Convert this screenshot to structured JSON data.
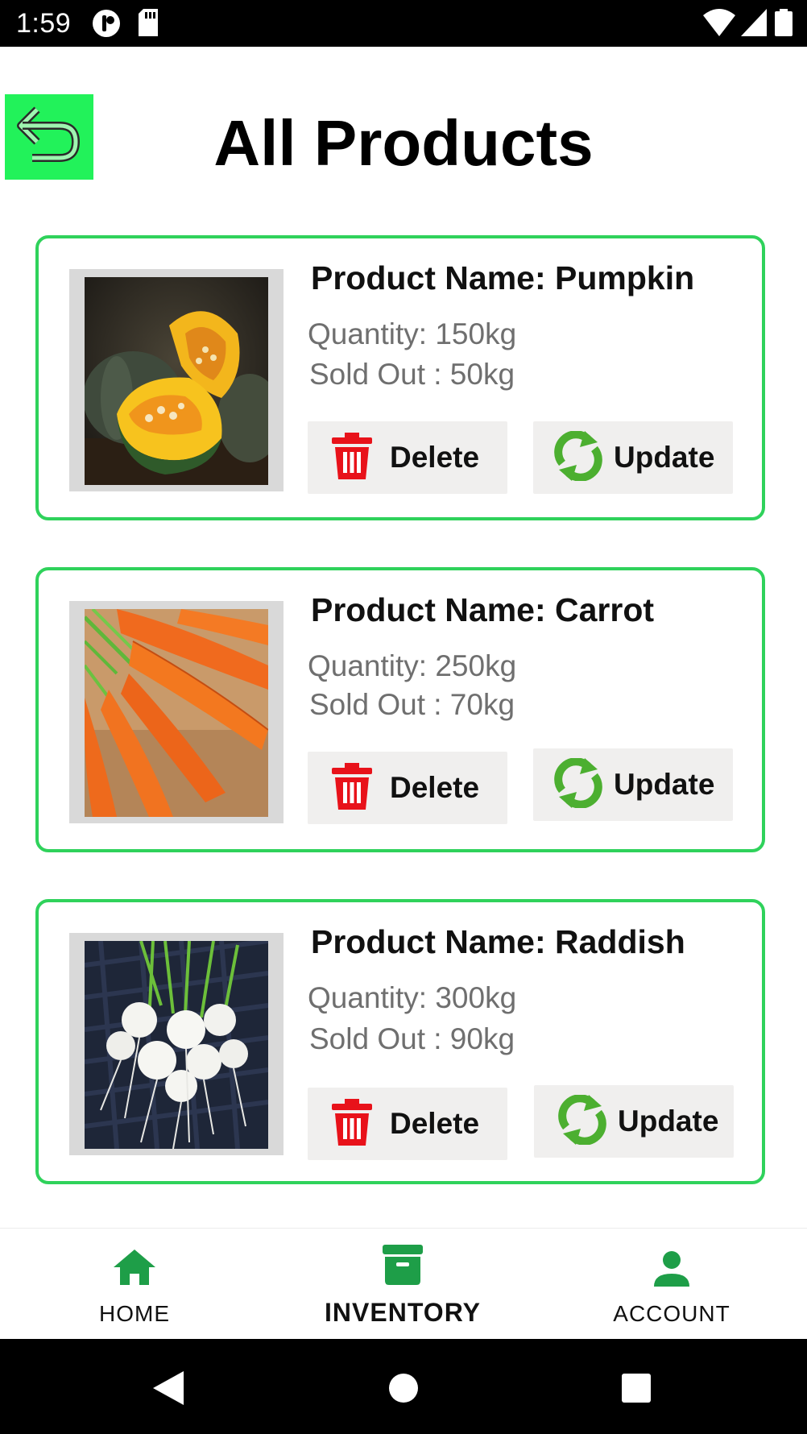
{
  "status_bar": {
    "time": "1:59"
  },
  "header": {
    "title": "All Products"
  },
  "products": [
    {
      "name": "Product Name: Pumpkin",
      "quantity": "Quantity: 150kg",
      "sold": "Sold Out : 50kg",
      "delete_label": "Delete",
      "update_label": "Update"
    },
    {
      "name": "Product Name: Carrot",
      "quantity": "Quantity: 250kg",
      "sold": "Sold Out : 70kg",
      "delete_label": "Delete",
      "update_label": "Update"
    },
    {
      "name": "Product Name: Raddish",
      "quantity": "Quantity: 300kg",
      "sold": "Sold Out : 90kg",
      "delete_label": "Delete",
      "update_label": "Update"
    }
  ],
  "bottom_nav": {
    "items": [
      {
        "label": "HOME",
        "icon": "home-icon"
      },
      {
        "label": "INVENTORY",
        "icon": "archive-icon",
        "active": true
      },
      {
        "label": "ACCOUNT",
        "icon": "person-icon"
      }
    ]
  },
  "colors": {
    "accent_green": "#22f25a",
    "card_border": "#2fd25b",
    "nav_green": "#1e9e48",
    "delete_red": "#e8121a",
    "update_green": "#4caf30"
  }
}
